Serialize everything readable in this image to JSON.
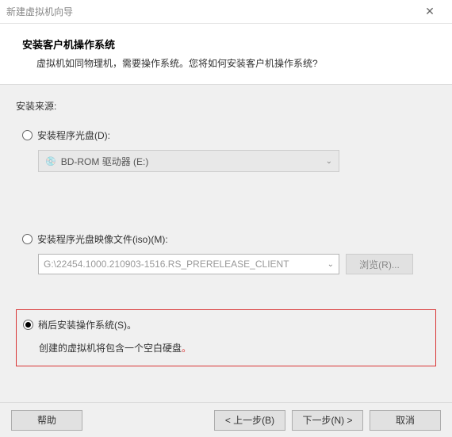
{
  "window": {
    "title": "新建虚拟机向导"
  },
  "header": {
    "title": "安装客户机操作系统",
    "subtitle": "虚拟机如同物理机，需要操作系统。您将如何安装客户机操作系统?"
  },
  "source": {
    "label": "安装来源:"
  },
  "options": {
    "disc": {
      "label": "安装程序光盘(D):",
      "dropdown_value": "BD-ROM 驱动器 (E:)"
    },
    "iso": {
      "label": "安装程序光盘映像文件(iso)(M):",
      "path_value": "G:\\22454.1000.210903-1516.RS_PRERELEASE_CLIENT",
      "browse_label": "浏览(R)..."
    },
    "later": {
      "label": "稍后安装操作系统(S)。",
      "description": "创建的虚拟机将包含一个空白硬盘",
      "trailing_dot": "。"
    }
  },
  "buttons": {
    "help": "帮助",
    "back": "< 上一步(B)",
    "next": "下一步(N) >",
    "cancel": "取消"
  }
}
